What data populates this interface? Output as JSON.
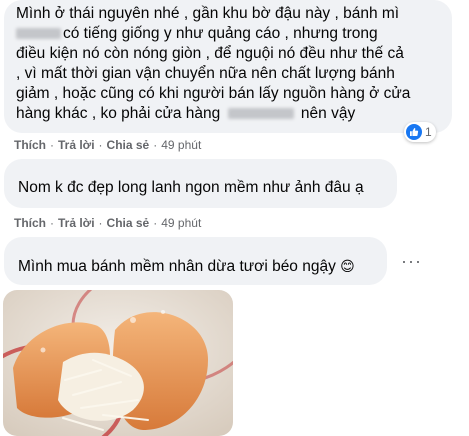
{
  "comments": [
    {
      "lines": [
        "Mình ở thái nguyên nhé , gần khu bờ đậu này , bánh mì",
        "có tiếng giống y như quảng cáo , nhưng trong",
        "điều kiện nó còn nóng giòn , để nguội nó đều như thế cả",
        ", vì mất thời gian vận chuyển nữa nên chất lượng bánh",
        "giảm , hoặc cũng có khi người bán lấy nguồn hàng ở cửa",
        "hàng khác , ko phải cửa hàng",
        "nên vậy"
      ],
      "reaction_count": "1",
      "actions": {
        "like": "Thích",
        "reply": "Trả lời",
        "share": "Chia sẻ",
        "time": "49 phút"
      }
    },
    {
      "text": "Nom k đc đẹp long lanh ngon mềm như ảnh đâu ạ",
      "actions": {
        "like": "Thích",
        "reply": "Trả lời",
        "share": "Chia sẻ",
        "time": "49 phút"
      }
    },
    {
      "text": "Mình mua bánh mềm nhân dừa tươi béo ngậy",
      "emoji": "😊"
    }
  ],
  "icons": {
    "reaction": "like-icon",
    "more": "more-options-icon",
    "photo": "bread-photo"
  },
  "colors": {
    "bubble": "#f0f2f5",
    "meta": "#65676b",
    "like_blue": "#1877f2"
  }
}
